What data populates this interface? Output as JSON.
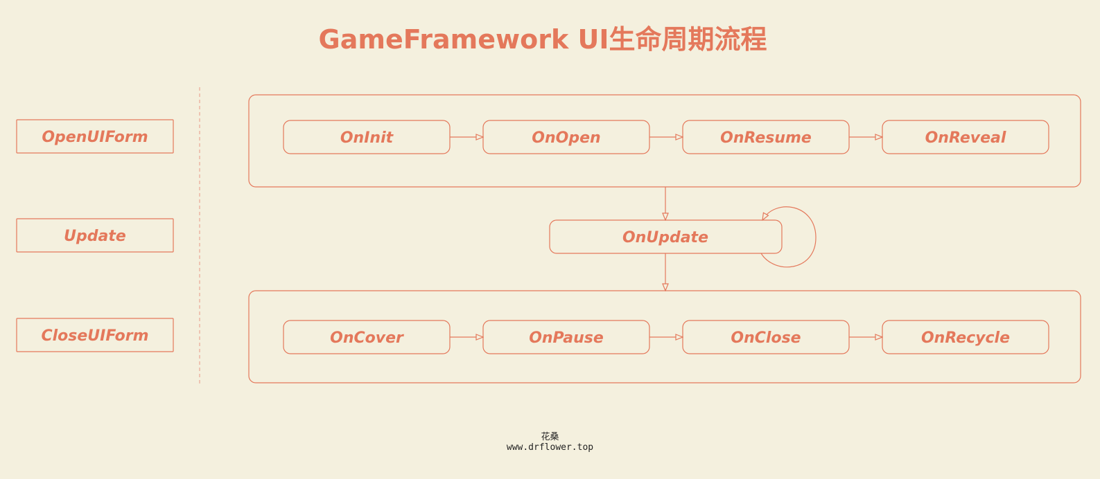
{
  "title": "GameFramework UI生命周期流程",
  "colors": {
    "background": "#f4f0de",
    "accent": "#e4785b",
    "divider": "#e9a795",
    "footer_text": "#222222"
  },
  "left_labels": {
    "open": "OpenUIForm",
    "update": "Update",
    "close": "CloseUIForm"
  },
  "open_group": {
    "init": "OnInit",
    "open": "OnOpen",
    "resume": "OnResume",
    "reveal": "OnReveal"
  },
  "update_node": "OnUpdate",
  "close_group": {
    "cover": "OnCover",
    "pause": "OnPause",
    "close": "OnClose",
    "recycle": "OnRecycle"
  },
  "footer": {
    "author": "花桑",
    "url": "www.drflower.top"
  }
}
